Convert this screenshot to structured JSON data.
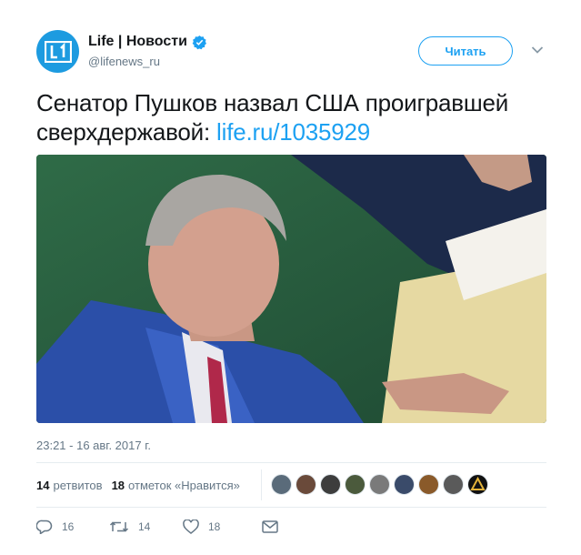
{
  "author": {
    "name": "Life | Новости",
    "handle": "@lifenews_ru",
    "avatar_color": "#1d9be0"
  },
  "follow_button": {
    "label": "Читать"
  },
  "tweet": {
    "text": "Сенатор Пушков назвал США проигравшей сверхдержавой: ",
    "link": "life.ru/1035929"
  },
  "photo": {
    "description_icon": "photo"
  },
  "timestamp": "23:21 - 16 авг. 2017 г.",
  "stats": {
    "retweets_count": "14",
    "retweets_label": "ретвитов",
    "likes_count": "18",
    "likes_label": "отметок «Нравится»"
  },
  "likers_colors": [
    "#5a6b7a",
    "#6a4a3a",
    "#3d3d3d",
    "#4b5a3c",
    "#7a7a7a",
    "#3a4b6a",
    "#8a5a2a",
    "#5a5a5a",
    "#2a2a2a"
  ],
  "actions": {
    "replies": "16",
    "retweets": "14",
    "likes": "18"
  },
  "colors": {
    "accent": "#1da1f2",
    "secondary_text": "#657786",
    "primary_text": "#14171a"
  }
}
